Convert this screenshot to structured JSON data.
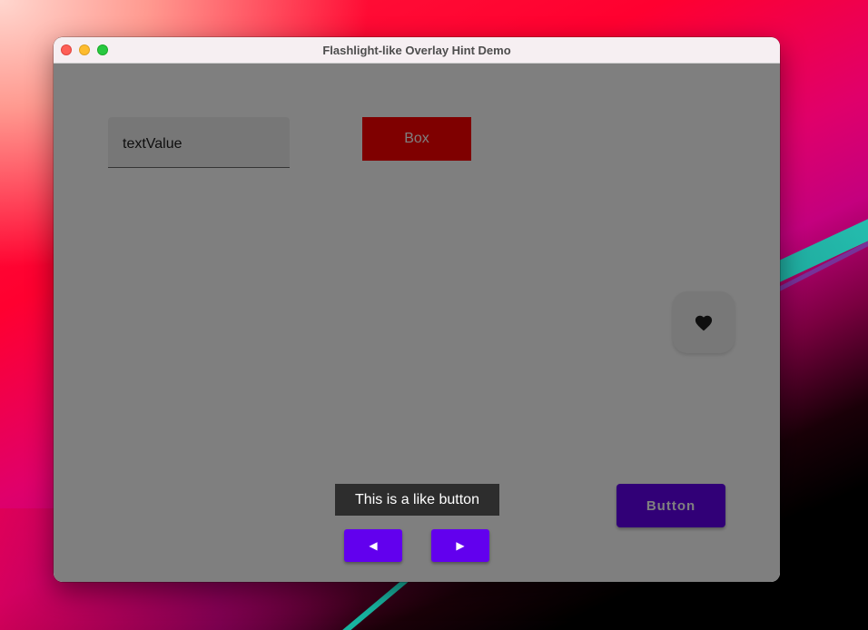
{
  "window": {
    "title": "Flashlight-like Overlay Hint Demo"
  },
  "content": {
    "text_field": {
      "value": "textValue"
    },
    "box": {
      "label": "Box"
    },
    "like_button": {
      "icon": "heart-icon"
    },
    "button": {
      "label": "Button"
    }
  },
  "overlay": {
    "hint_text": "This is a like button",
    "prev_icon": "◀",
    "next_icon": "▶"
  },
  "colors": {
    "accent": "#6200ee",
    "box_red": "#ff0000",
    "hint_bg": "#2d2d2d",
    "overlay_dim": "rgba(0,0,0,0.5)"
  }
}
